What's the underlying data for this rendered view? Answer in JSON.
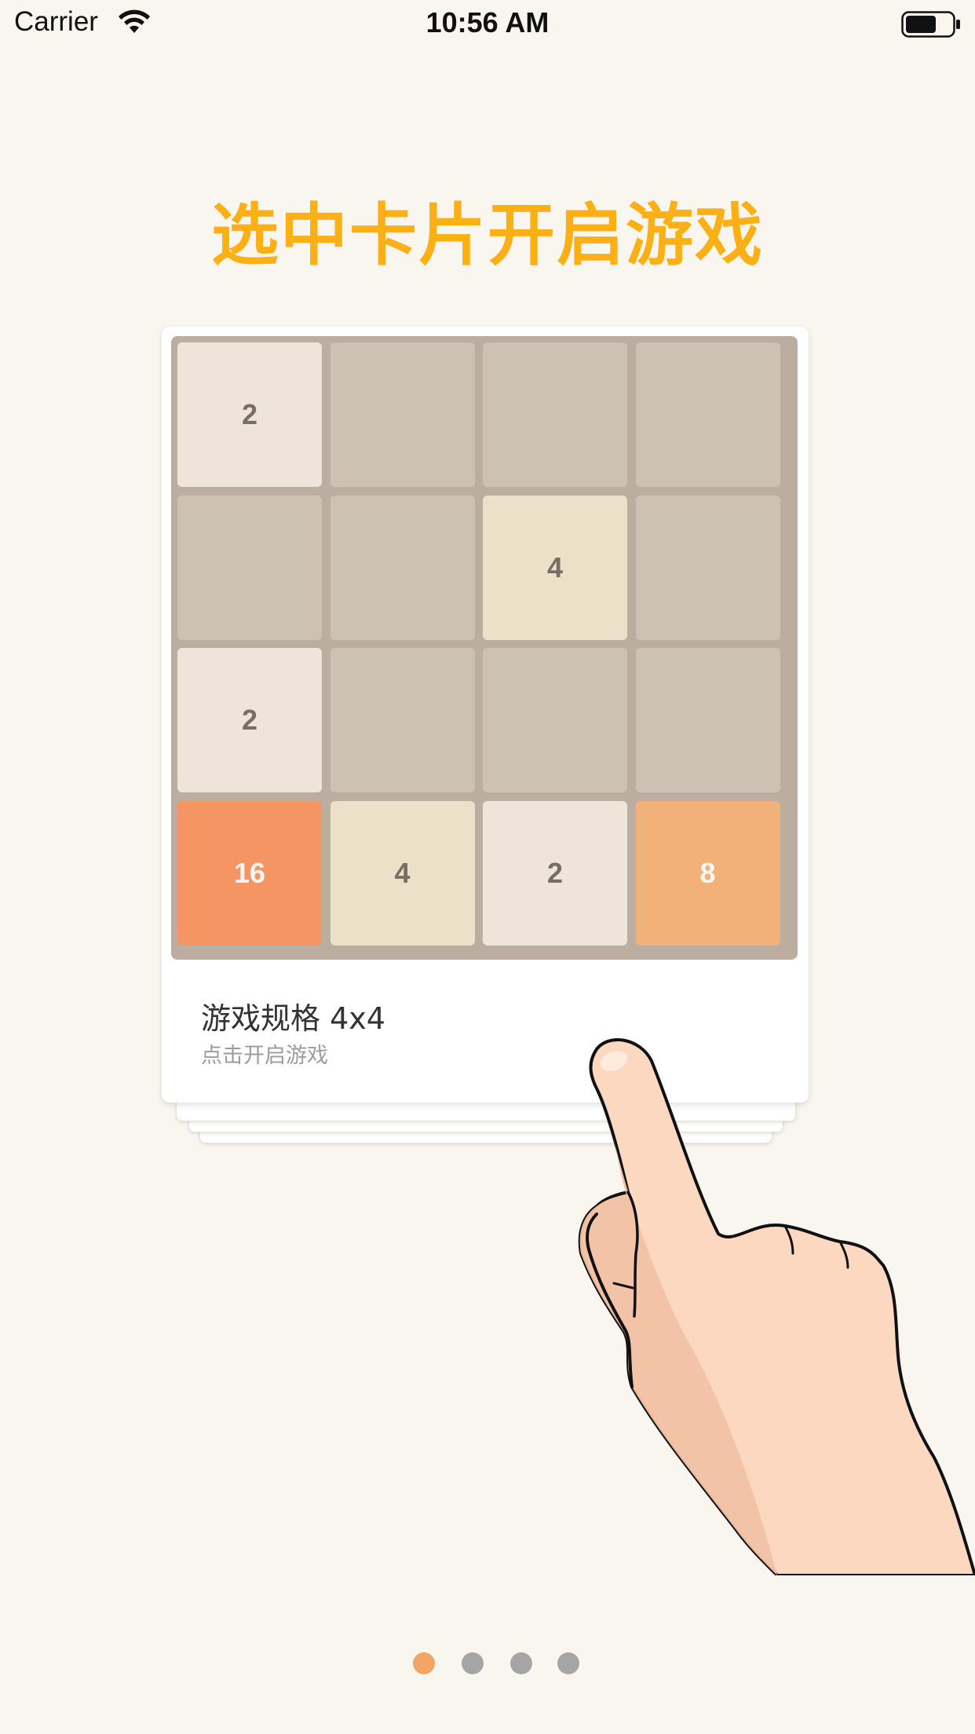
{
  "status_bar": {
    "carrier": "Carrier",
    "time": "10:56 AM",
    "battery_level": 0.65
  },
  "headline": "选中卡片开启游戏",
  "card": {
    "title": "游戏规格 4x4",
    "subtitle": "点击开启游戏"
  },
  "board": {
    "rows": [
      [
        "2",
        "",
        "",
        ""
      ],
      [
        "",
        "",
        "4",
        ""
      ],
      [
        "2",
        "",
        "",
        ""
      ],
      [
        "16",
        "4",
        "2",
        "8"
      ]
    ]
  },
  "pagination": {
    "total": 4,
    "active_index": 0
  },
  "colors": {
    "background": "#F9F6F0",
    "headline": "#FDB015",
    "board": "#BBADA0",
    "empty_tile": "#CDC1B4",
    "tile_2": "#EEE4DA",
    "tile_4": "#EDE0C8",
    "tile_8": "#F2B179",
    "tile_16": "#F59563",
    "dot_active": "#F2A564",
    "dot_inactive": "#A5A5A5"
  },
  "icons": {
    "wifi": "wifi-icon",
    "battery": "battery-icon",
    "hand": "pointing-hand-icon"
  }
}
